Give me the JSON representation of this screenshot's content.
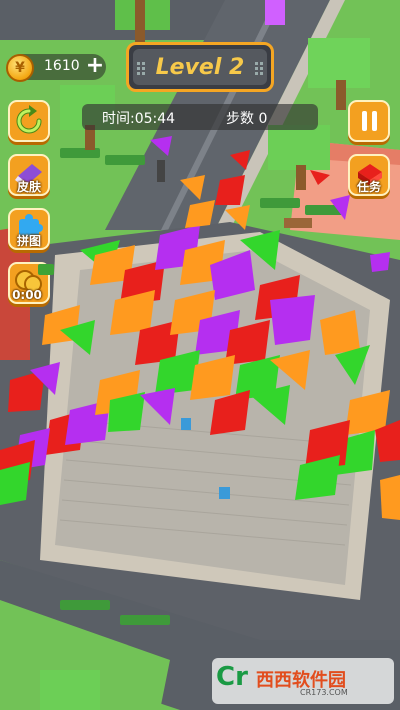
{
  "hud": {
    "coins": "1610",
    "plus_symbol": "+",
    "level_title": "Level 2",
    "timer_text": "时间:05:44",
    "steps_text": "步数 0"
  },
  "side_buttons": {
    "refresh_icon": "refresh-icon",
    "skin_label": "皮肤",
    "puzzle_label": "拼图",
    "timer_bonus_label": "0:00",
    "task_label": "任务"
  },
  "watermark": {
    "logo_text": "Cr",
    "brand_text": "西西软件园",
    "url_text": "CR173.COM"
  },
  "colors": {
    "accent_orange": "#f3a020",
    "level_text": "#f7c94a",
    "confetti_orange": "#ff9a1f",
    "confetti_purple": "#b52ff0",
    "confetti_red": "#e8201c",
    "confetti_green": "#33d62c"
  }
}
